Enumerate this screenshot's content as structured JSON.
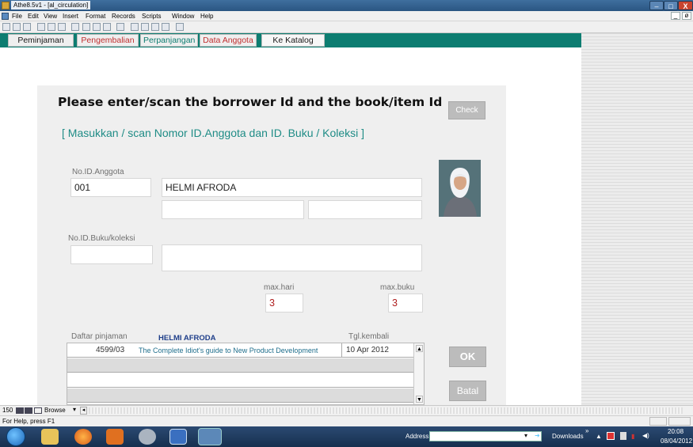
{
  "window": {
    "title": "Athe8.5v1 - [al_circulation]",
    "min": "–",
    "max": "□",
    "close": "X"
  },
  "menu": {
    "items": [
      "File",
      "Edit",
      "View",
      "Insert",
      "Format",
      "Records",
      "Scripts",
      "Window",
      "Help"
    ],
    "doc_controls": [
      "_",
      "ø"
    ]
  },
  "nav": {
    "tabs": [
      "Peminjaman",
      "Pengembalian",
      "Perpanjangan",
      "Data Anggota",
      "Ke Katalog"
    ]
  },
  "form": {
    "heading": "Please enter/scan the borrower Id and the book/item Id",
    "subheading": "[ Masukkan / scan  Nomor ID.Anggota  dan ID. Buku / Koleksi ]",
    "check_label": "Check",
    "member_id_label": "No.ID.Anggota",
    "member_id_value": "001",
    "member_name_value": "HELMI AFRODA",
    "book_id_label": "No.ID.Buku/koleksi",
    "max_hari_label": "max.hari",
    "max_hari_value": "3",
    "max_buku_label": "max.buku",
    "max_buku_value": "3",
    "list_label": "Daftar pinjaman",
    "list_borrower": "HELMI AFRODA",
    "return_date_label": "Tgl.kembali",
    "loans": [
      {
        "id": "4599/03",
        "title": "The Complete Idiot's guide to New Product Development",
        "due": "10 Apr 2012"
      }
    ],
    "ok_label": "OK",
    "batal_label": "Batal"
  },
  "fmstrip": {
    "zoom": "150",
    "mode": "Browse"
  },
  "statusbar": {
    "help_text": "For Help, press F1"
  },
  "taskbar": {
    "address_label": "Address",
    "downloads_label": "Downloads",
    "time": "20:08",
    "date": "08/04/2012"
  }
}
